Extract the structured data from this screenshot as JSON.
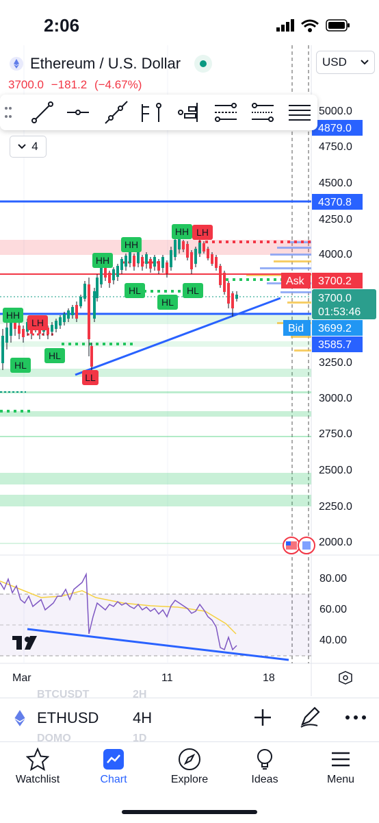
{
  "status_bar": {
    "time": "2:06"
  },
  "header": {
    "title": "Ethereum / U.S. Dollar",
    "price": "3700.0",
    "change": "−181.2",
    "change_pct": "(−4.67%)",
    "currency": "USD"
  },
  "toolbar": {
    "items": [
      "trend-line-tool",
      "horizontal-line-tool",
      "ray-tool",
      "price-range-tool",
      "long-position-tool",
      "fib-retracement-tool",
      "pitchfork-tool",
      "gann-tool"
    ],
    "collapse_count": "4"
  },
  "price_axis": {
    "ticks": [
      "5000.0",
      "4750.0",
      "4500.0",
      "4250.0",
      "4000.0",
      "3250.0",
      "3000.0",
      "2750.0",
      "2500.0",
      "2250.0",
      "2000.0"
    ],
    "tags": {
      "blue_top": "4879.0",
      "blue_mid": "4370.8",
      "ask_label": "Ask",
      "ask_price": "3700.2",
      "last_price": "3700.0",
      "countdown": "01:53:46",
      "bid_label": "Bid",
      "bid_price": "3699.2",
      "blue_low": "3585.7"
    }
  },
  "labels": {
    "hh": "HH",
    "hl": "HL",
    "lh": "LH",
    "ll": "LL"
  },
  "rsi_axis": {
    "ticks": [
      "80.00",
      "60.00",
      "40.00"
    ]
  },
  "time_axis": {
    "ticks": [
      "Mar",
      "11",
      "18"
    ]
  },
  "bottom_bar": {
    "ghost_top": "BTCUSDT",
    "ghost_top_int": "2H",
    "symbol": "ETHUSD",
    "interval": "4H",
    "ghost_bottom": "DOMO",
    "ghost_bottom_int": "1D"
  },
  "nav": {
    "watchlist": "Watchlist",
    "chart": "Chart",
    "explore": "Explore",
    "ideas": "Ideas",
    "menu": "Menu"
  },
  "colors": {
    "accent": "#2962ff",
    "up": "#089981",
    "down": "#f23645",
    "hh_green": "#22c55e",
    "rsi": "#7e57c2"
  }
}
